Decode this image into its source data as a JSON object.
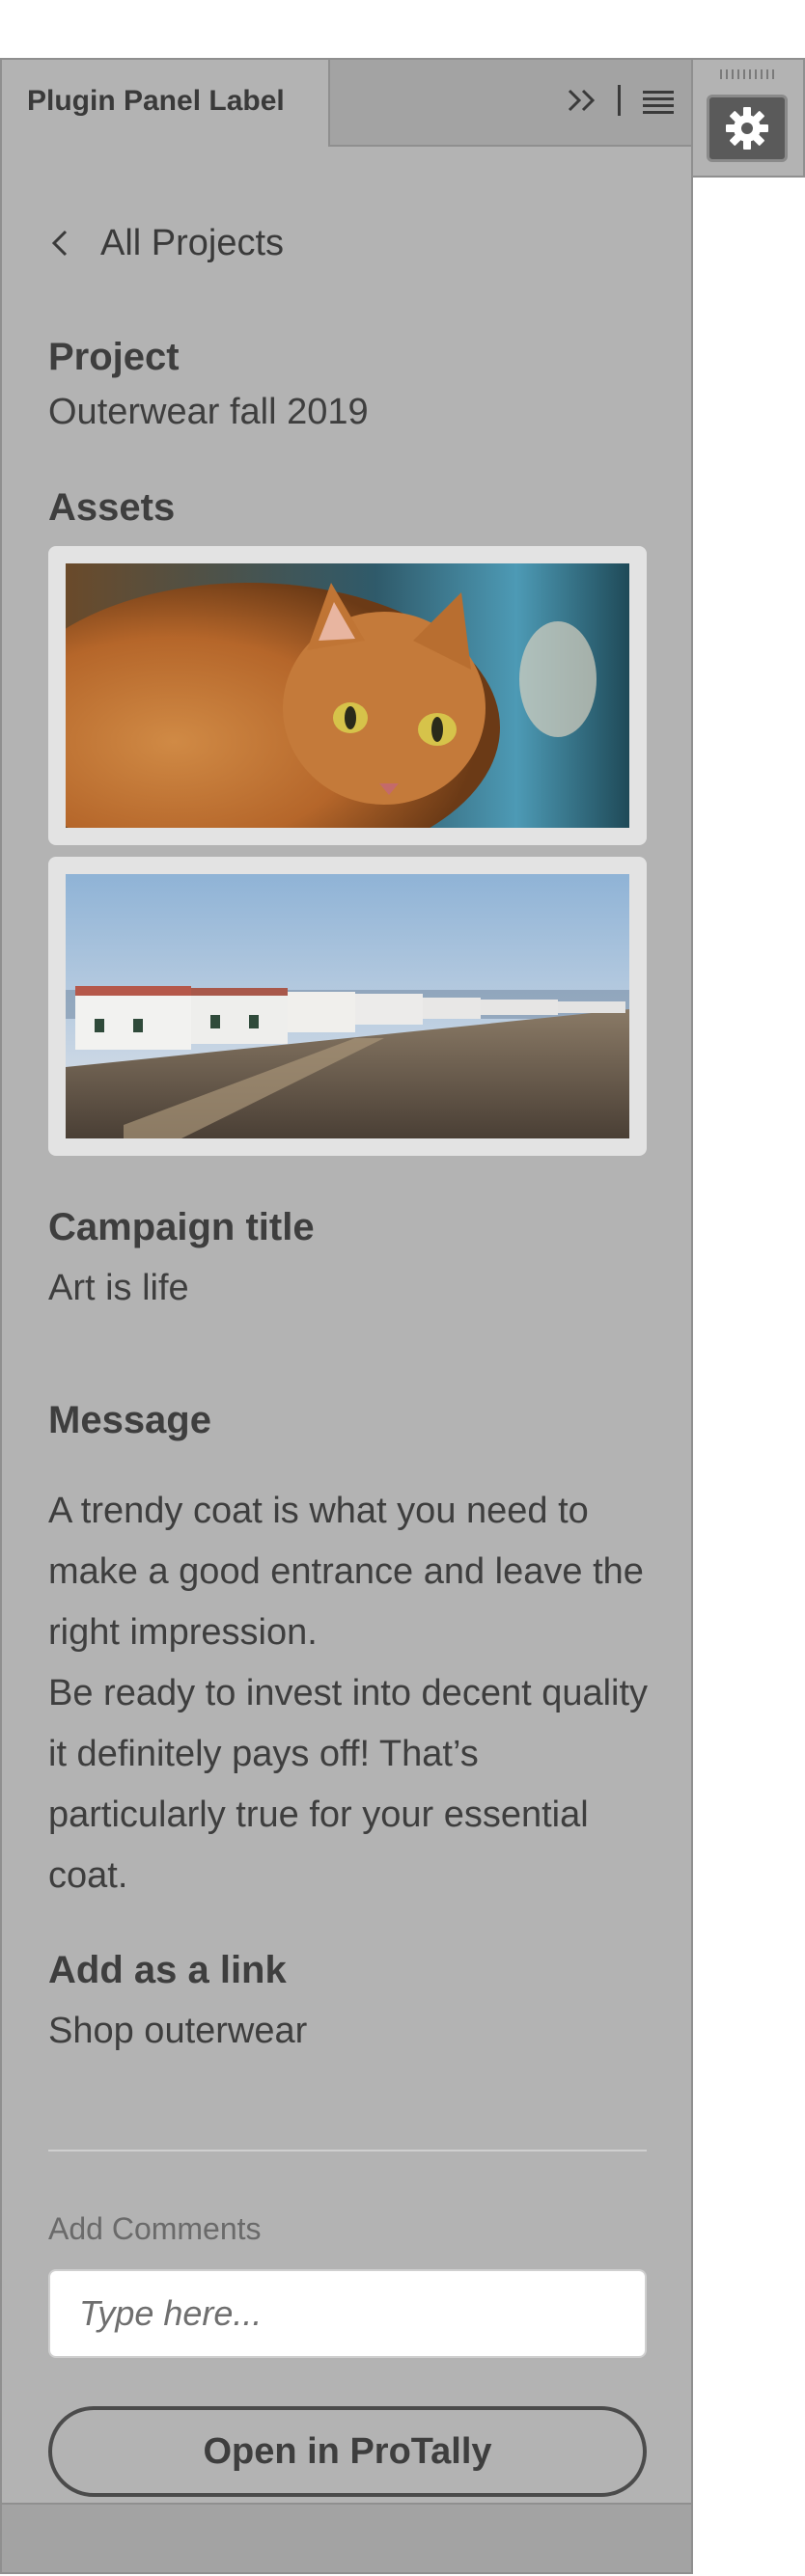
{
  "panel": {
    "tab_label": "Plugin Panel Label",
    "tab_icons": [
      "chevrons-right-icon",
      "menu-icon"
    ]
  },
  "nav": {
    "back_label": "All Projects",
    "back_icon": "chevron-left-icon"
  },
  "project": {
    "heading": "Project",
    "value": "Outerwear fall 2019"
  },
  "assets": {
    "heading": "Assets",
    "items": [
      {
        "subject": "orange tabby cat"
      },
      {
        "subject": "white coastal houses"
      }
    ]
  },
  "campaign": {
    "heading": "Campaign title",
    "value": "Art is life"
  },
  "message": {
    "heading": "Message",
    "paragraphs": [
      "A trendy coat is what you need to make a good entrance and leave the right impression.",
      "Be ready to invest into decent quality it definitely pays off! That’s particularly true for your essential coat."
    ]
  },
  "link": {
    "heading": "Add as a link",
    "value": "Shop outerwear"
  },
  "comments": {
    "label": "Add Comments",
    "placeholder": "Type here...",
    "value": ""
  },
  "actions": {
    "open_label": "Open in ProTally"
  },
  "dock": {
    "icon": "gear-icon"
  },
  "colors": {
    "panel_bg": "#b3b3b3",
    "tabbar_bg": "#a3a3a3",
    "text": "#3e3e3e",
    "card_bg": "#e3e3e3"
  }
}
